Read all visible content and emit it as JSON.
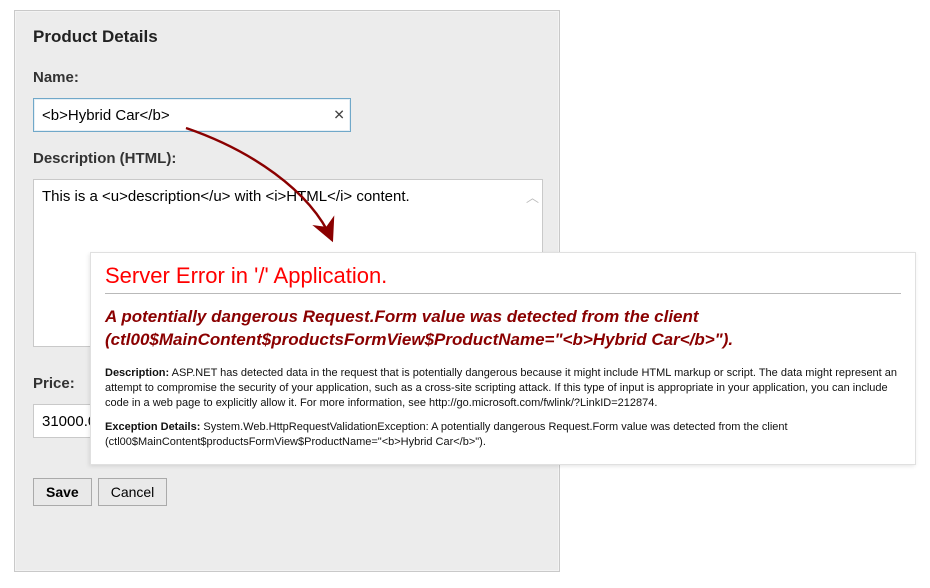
{
  "form": {
    "title": "Product Details",
    "name_label": "Name:",
    "name_value": "<b>Hybrid Car</b>",
    "desc_label": "Description (HTML):",
    "desc_value": "This is a <u>description</u> with <i>HTML</i> content.",
    "price_label": "Price:",
    "price_value": "31000.0",
    "save_label": "Save",
    "cancel_label": "Cancel"
  },
  "error": {
    "heading": "Server Error in '/' Application.",
    "subheading": "A potentially dangerous Request.Form value was detected from the client (ctl00$MainContent$productsFormView$ProductName=\"<b>Hybrid Car</b>\").",
    "desc_label": "Description:",
    "desc_text": " ASP.NET has detected data in the request that is potentially dangerous because it might include HTML markup or script. The data might represent an attempt to compromise the security of your application, such as a cross-site scripting attack. If this type of input is appropriate in your application, you can include code in a web page to explicitly allow it. For more information, see http://go.microsoft.com/fwlink/?LinkID=212874.",
    "exc_label": "Exception Details:",
    "exc_text": " System.Web.HttpRequestValidationException: A potentially dangerous Request.Form value was detected from the client (ctl00$MainContent$productsFormView$ProductName=\"<b>Hybrid Car</b>\")."
  },
  "arrow": {
    "color": "#8a0000"
  }
}
